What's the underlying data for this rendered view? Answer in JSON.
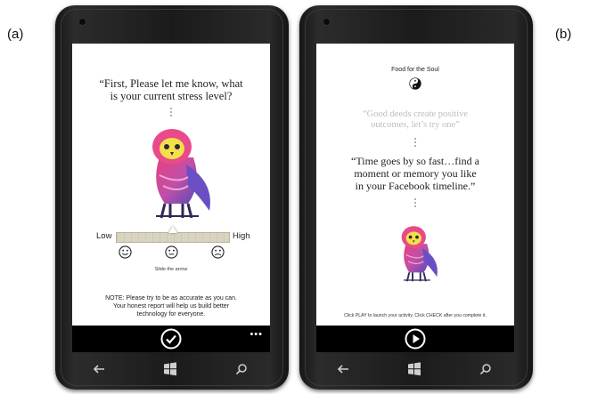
{
  "labels": {
    "a": "(a)",
    "b": "(b)"
  },
  "screen_a": {
    "question": [
      "“First, Please let me know, what",
      "is your current stress level?"
    ],
    "scale_low": "Low",
    "scale_high": "High",
    "slide_hint": "Slide the arrow",
    "note": [
      "NOTE: Please try to be as accurate as you can.",
      "Your honest report will help us build better",
      "technology for everyone."
    ],
    "action_icon": "check-circle-icon",
    "more": "•••"
  },
  "screen_b": {
    "heading": "Food for the Soul",
    "quote_faded": [
      "“Good deeds create positive",
      "outcomes, let’s try one”"
    ],
    "quote_main": [
      "“Time goes by so fast…find a",
      "moment or memory you like",
      "in your Facebook timeline.”"
    ],
    "footer": "Click PLAY to launch your activity. Click CHECK after you complete it.",
    "action_icon": "play-circle-icon"
  },
  "colors": {
    "screen": "#ffffff",
    "appbar": "#000000",
    "phone": "#1b1b1b"
  }
}
